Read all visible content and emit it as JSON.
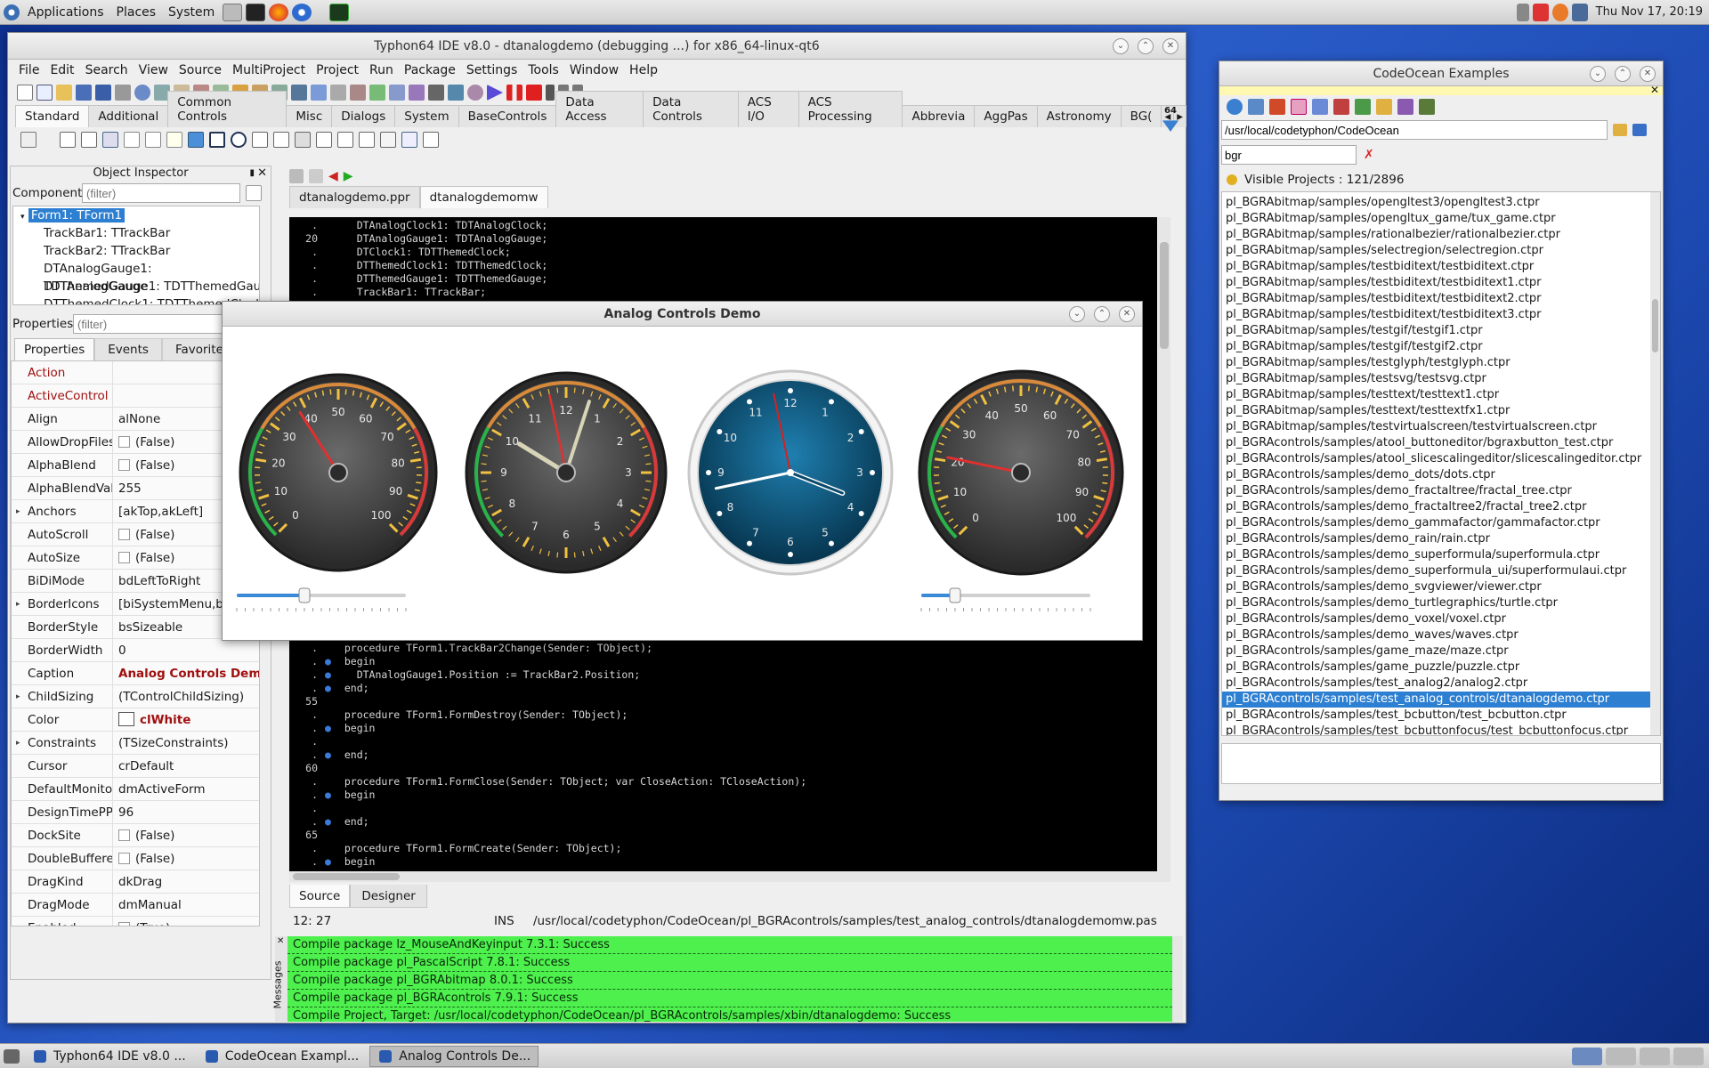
{
  "top_panel": {
    "menus": [
      "Applications",
      "Places",
      "System"
    ],
    "clock": "Thu Nov 17, 20:19"
  },
  "ide": {
    "title": "Typhon64 IDE v8.0 - dtanalogdemo (debugging ...) for x86_64-linux-qt6",
    "menu": [
      "File",
      "Edit",
      "Search",
      "View",
      "Source",
      "MultiProject",
      "Project",
      "Run",
      "Package",
      "Settings",
      "Tools",
      "Window",
      "Help"
    ],
    "palette_tabs": [
      "Standard",
      "Additional",
      "Common Controls",
      "Misc",
      "Dialogs",
      "System",
      "BaseControls",
      "Data Access",
      "Data Controls",
      "ACS I/O",
      "ACS Processing",
      "Abbrevia",
      "AggPas",
      "Astronomy",
      "BG("
    ],
    "palette_badge": "64",
    "oi": {
      "title": "Object Inspector",
      "components_label": "Components",
      "filter_placeholder": "(filter)",
      "tree": [
        "Form1: TForm1",
        "TrackBar1: TTrackBar",
        "TrackBar2: TTrackBar",
        "DTAnalogGauge1: TDTAnalogGauge",
        "DTThemedGauge1: TDTThemedGaug",
        "DTThemedClock1: TDTThemedClock"
      ],
      "properties_label": "Properties",
      "tabs": [
        "Properties",
        "Events",
        "Favorites"
      ],
      "props": [
        {
          "n": "Action",
          "v": "",
          "red": true
        },
        {
          "n": "ActiveControl",
          "v": "",
          "red": true
        },
        {
          "n": "Align",
          "v": "alNone"
        },
        {
          "n": "AllowDropFiles",
          "v": "(False)",
          "cb": true
        },
        {
          "n": "AlphaBlend",
          "v": "(False)",
          "cb": true
        },
        {
          "n": "AlphaBlendValu",
          "v": "255"
        },
        {
          "n": "Anchors",
          "v": "[akTop,akLeft]",
          "exp": true
        },
        {
          "n": "AutoScroll",
          "v": "(False)",
          "cb": true
        },
        {
          "n": "AutoSize",
          "v": "(False)",
          "cb": true
        },
        {
          "n": "BiDiMode",
          "v": "bdLeftToRight"
        },
        {
          "n": "BorderIcons",
          "v": "[biSystemMenu,biMi",
          "exp": true
        },
        {
          "n": "BorderStyle",
          "v": "bsSizeable"
        },
        {
          "n": "BorderWidth",
          "v": "0"
        },
        {
          "n": "Caption",
          "v": "Analog Controls Demo",
          "bold": true
        },
        {
          "n": "ChildSizing",
          "v": "(TControlChildSizing)",
          "exp": true
        },
        {
          "n": "Color",
          "v": "clWhite",
          "bold": true,
          "swatch": true
        },
        {
          "n": "Constraints",
          "v": "(TSizeConstraints)",
          "exp": true
        },
        {
          "n": "Cursor",
          "v": "crDefault"
        },
        {
          "n": "DefaultMonitor",
          "v": "dmActiveForm"
        },
        {
          "n": "DesignTimePPI",
          "v": "96"
        },
        {
          "n": "DockSite",
          "v": "(False)",
          "cb": true
        },
        {
          "n": "DoubleBuffere",
          "v": "(False)",
          "cb": true
        },
        {
          "n": "DragKind",
          "v": "dkDrag"
        },
        {
          "n": "DragMode",
          "v": "dmManual"
        },
        {
          "n": "Enabled",
          "v": "(True)",
          "cb": true
        }
      ]
    },
    "editor": {
      "tabs": [
        "dtanalogdemo.ppr",
        "dtanalogdemomw"
      ],
      "lines_top": [
        {
          "g": ".",
          "t": "    DTAnalogClock1: TDTAnalogClock;"
        },
        {
          "g": "20",
          "t": "    DTAnalogGauge1: TDTAnalogGauge;"
        },
        {
          "g": ".",
          "t": "    DTClock1: TDTThemedClock;"
        },
        {
          "g": ".",
          "t": "    DTThemedClock1: TDTThemedClock;"
        },
        {
          "g": ".",
          "t": "    DTThemedGauge1: TDTThemedGauge;"
        },
        {
          "g": ".",
          "t": "    TrackBar1: TTrackBar;"
        }
      ],
      "lines_bottom": [
        {
          "g": ".",
          "t": "  procedure TForm1.TrackBar2Change(Sender: TObject);"
        },
        {
          "g": ".",
          "t": "  begin",
          "dot": true
        },
        {
          "g": ".",
          "t": "    DTAnalogGauge1.Position := TrackBar2.Position;",
          "dot": true
        },
        {
          "g": ".",
          "t": "  end;",
          "dot": true
        },
        {
          "g": "55",
          "t": ""
        },
        {
          "g": ".",
          "t": "  procedure TForm1.FormDestroy(Sender: TObject);"
        },
        {
          "g": ".",
          "t": "  begin",
          "dot": true
        },
        {
          "g": ".",
          "t": ""
        },
        {
          "g": ".",
          "t": "  end;",
          "dot": true
        },
        {
          "g": "60",
          "t": ""
        },
        {
          "g": ".",
          "t": "  procedure TForm1.FormClose(Sender: TObject; var CloseAction: TCloseAction);"
        },
        {
          "g": ".",
          "t": "  begin",
          "dot": true
        },
        {
          "g": ".",
          "t": ""
        },
        {
          "g": ".",
          "t": "  end;",
          "dot": true
        },
        {
          "g": "65",
          "t": ""
        },
        {
          "g": ".",
          "t": "  procedure TForm1.FormCreate(Sender: TObject);"
        },
        {
          "g": ".",
          "t": "  begin",
          "dot": true
        }
      ],
      "bottom_tabs": [
        "Source",
        "Designer"
      ],
      "status": {
        "pos": "12: 27",
        "mode": "INS",
        "file": "/usr/local/codetyphon/CodeOcean/pl_BGRAcontrols/samples/test_analog_controls/dtanalogdemomw.pas"
      }
    },
    "messages_label": "Messages",
    "messages": [
      "Compile package lz_MouseAndKeyinput 7.3.1: Success",
      "Compile package pl_PascalScript 7.8.1: Success",
      "Compile package pl_BGRAbitmap 8.0.1: Success",
      "Compile package pl_BGRAcontrols 7.9.1: Success",
      "Compile Project, Target: /usr/local/codetyphon/CodeOcean/pl_BGRAcontrols/samples/xbin/dtanalogdemo: Success"
    ]
  },
  "demo": {
    "title": "Analog Controls Demo",
    "gauge1": {
      "labels": [
        "0",
        "10",
        "20",
        "30",
        "40",
        "50",
        "60",
        "70",
        "80",
        "90",
        "100"
      ],
      "value": 38
    },
    "clock1": {
      "labels": [
        "12",
        "1",
        "2",
        "3",
        "4",
        "5",
        "6",
        "7",
        "8",
        "9",
        "10",
        "11"
      ],
      "time": "10:03:58"
    },
    "clock2": {
      "labels": [
        "12",
        "1",
        "2",
        "3",
        "4",
        "5",
        "6",
        "7",
        "8",
        "9",
        "10",
        "11"
      ],
      "time": "3:43:58"
    },
    "gauge2": {
      "labels": [
        "0",
        "10",
        "20",
        "30",
        "40",
        "50",
        "60",
        "70",
        "80",
        "90",
        "100"
      ],
      "value": 21
    },
    "trackbar1": {
      "value": 0.4
    },
    "trackbar2": {
      "value": 0.2
    }
  },
  "examples": {
    "title": "CodeOcean Examples",
    "path": "/usr/local/codetyphon/CodeOcean",
    "search": "bgr",
    "visible": "Visible Projects : 121/2896",
    "items": [
      "pl_BGRAbitmap/samples/opengltest3/opengltest3.ctpr",
      "pl_BGRAbitmap/samples/opengltux_game/tux_game.ctpr",
      "pl_BGRAbitmap/samples/rationalbezier/rationalbezier.ctpr",
      "pl_BGRAbitmap/samples/selectregion/selectregion.ctpr",
      "pl_BGRAbitmap/samples/testbiditext/testbiditext.ctpr",
      "pl_BGRAbitmap/samples/testbiditext/testbiditext1.ctpr",
      "pl_BGRAbitmap/samples/testbiditext/testbiditext2.ctpr",
      "pl_BGRAbitmap/samples/testbiditext/testbiditext3.ctpr",
      "pl_BGRAbitmap/samples/testgif/testgif1.ctpr",
      "pl_BGRAbitmap/samples/testgif/testgif2.ctpr",
      "pl_BGRAbitmap/samples/testglyph/testglyph.ctpr",
      "pl_BGRAbitmap/samples/testsvg/testsvg.ctpr",
      "pl_BGRAbitmap/samples/testtext/testtext1.ctpr",
      "pl_BGRAbitmap/samples/testtext/testtextfx1.ctpr",
      "pl_BGRAbitmap/samples/testvirtualscreen/testvirtualscreen.ctpr",
      "pl_BGRAcontrols/samples/atool_buttoneditor/bgraxbutton_test.ctpr",
      "pl_BGRAcontrols/samples/atool_slicescalingeditor/slicescalingeditor.ctpr",
      "pl_BGRAcontrols/samples/demo_dots/dots.ctpr",
      "pl_BGRAcontrols/samples/demo_fractaltree/fractal_tree.ctpr",
      "pl_BGRAcontrols/samples/demo_fractaltree2/fractal_tree2.ctpr",
      "pl_BGRAcontrols/samples/demo_gammafactor/gammafactor.ctpr",
      "pl_BGRAcontrols/samples/demo_rain/rain.ctpr",
      "pl_BGRAcontrols/samples/demo_superformula/superformula.ctpr",
      "pl_BGRAcontrols/samples/demo_superformula_ui/superformulaui.ctpr",
      "pl_BGRAcontrols/samples/demo_svgviewer/viewer.ctpr",
      "pl_BGRAcontrols/samples/demo_turtlegraphics/turtle.ctpr",
      "pl_BGRAcontrols/samples/demo_voxel/voxel.ctpr",
      "pl_BGRAcontrols/samples/demo_waves/waves.ctpr",
      "pl_BGRAcontrols/samples/game_maze/maze.ctpr",
      "pl_BGRAcontrols/samples/game_puzzle/puzzle.ctpr",
      "pl_BGRAcontrols/samples/test_analog2/analog2.ctpr",
      "pl_BGRAcontrols/samples/test_analog_controls/dtanalogdemo.ctpr",
      "pl_BGRAcontrols/samples/test_bcbutton/test_bcbutton.ctpr",
      "pl_BGRAcontrols/samples/test_bcbuttonfocus/test_bcbuttonfocus.ctpr"
    ],
    "selected_index": 31
  },
  "taskbar": [
    "Typhon64 IDE v8.0 ...",
    "CodeOcean Exampl...",
    "Analog Controls De..."
  ]
}
